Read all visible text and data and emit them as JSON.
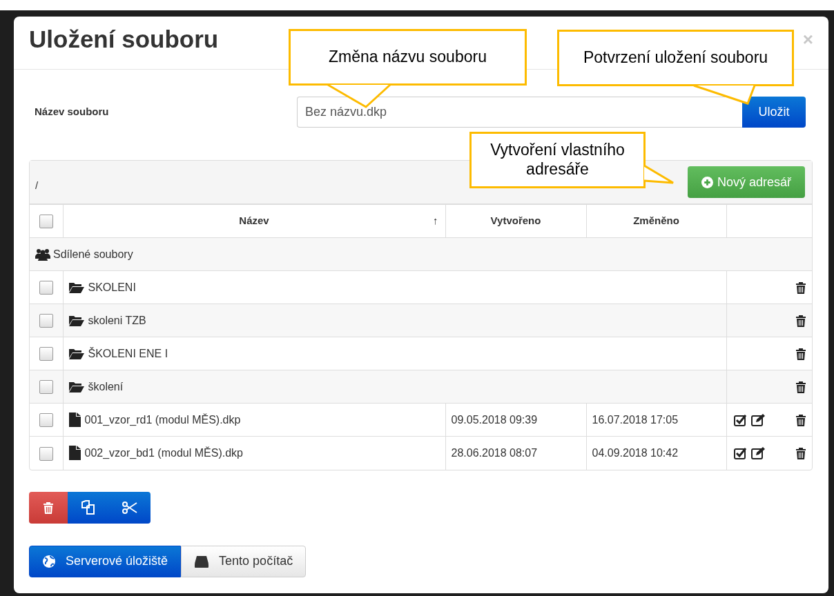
{
  "dialog": {
    "title": "Uložení souboru",
    "close": "×"
  },
  "filename": {
    "label": "Název souboru",
    "value": "Bez názvu.dkp",
    "save": "Uložit"
  },
  "browser": {
    "path": "/",
    "new_folder": "Nový adresář"
  },
  "table": {
    "select_all": {
      "checked": false
    },
    "columns": [
      {
        "label": "Název",
        "sort": "↑"
      },
      {
        "label": "Vytvořeno"
      },
      {
        "label": "Změněno"
      }
    ],
    "group": "Sdílené soubory",
    "rows": [
      {
        "kind": "folder",
        "name": "SKOLENI",
        "checked": false
      },
      {
        "kind": "folder",
        "name": "skoleni TZB",
        "checked": false
      },
      {
        "kind": "folder",
        "name": "ŠKOLENI ENE I",
        "checked": false
      },
      {
        "kind": "folder",
        "name": "školení",
        "checked": false
      },
      {
        "kind": "file",
        "name": "001_vzor_rd1 (modul MĚS).dkp",
        "created": "09.05.2018 09:39",
        "modified": "16.07.2018 17:05",
        "checked": false
      },
      {
        "kind": "file",
        "name": "002_vzor_bd1 (modul MĚS).dkp",
        "created": "28.06.2018 08:07",
        "modified": "04.09.2018 10:42",
        "checked": false
      }
    ]
  },
  "actions": [
    {
      "kind": "delete"
    },
    {
      "kind": "copy"
    },
    {
      "kind": "cut"
    }
  ],
  "storage": [
    {
      "kind": "server",
      "label": "Serverové úložiště",
      "selected": true
    },
    {
      "kind": "local",
      "label": "Tento počítač",
      "selected": false
    }
  ],
  "callouts": [
    {
      "text": "Změna názvu souboru"
    },
    {
      "text": "Potvrzení uložení souboru"
    },
    {
      "text": "Vytvoření vlastního adresáře"
    }
  ]
}
